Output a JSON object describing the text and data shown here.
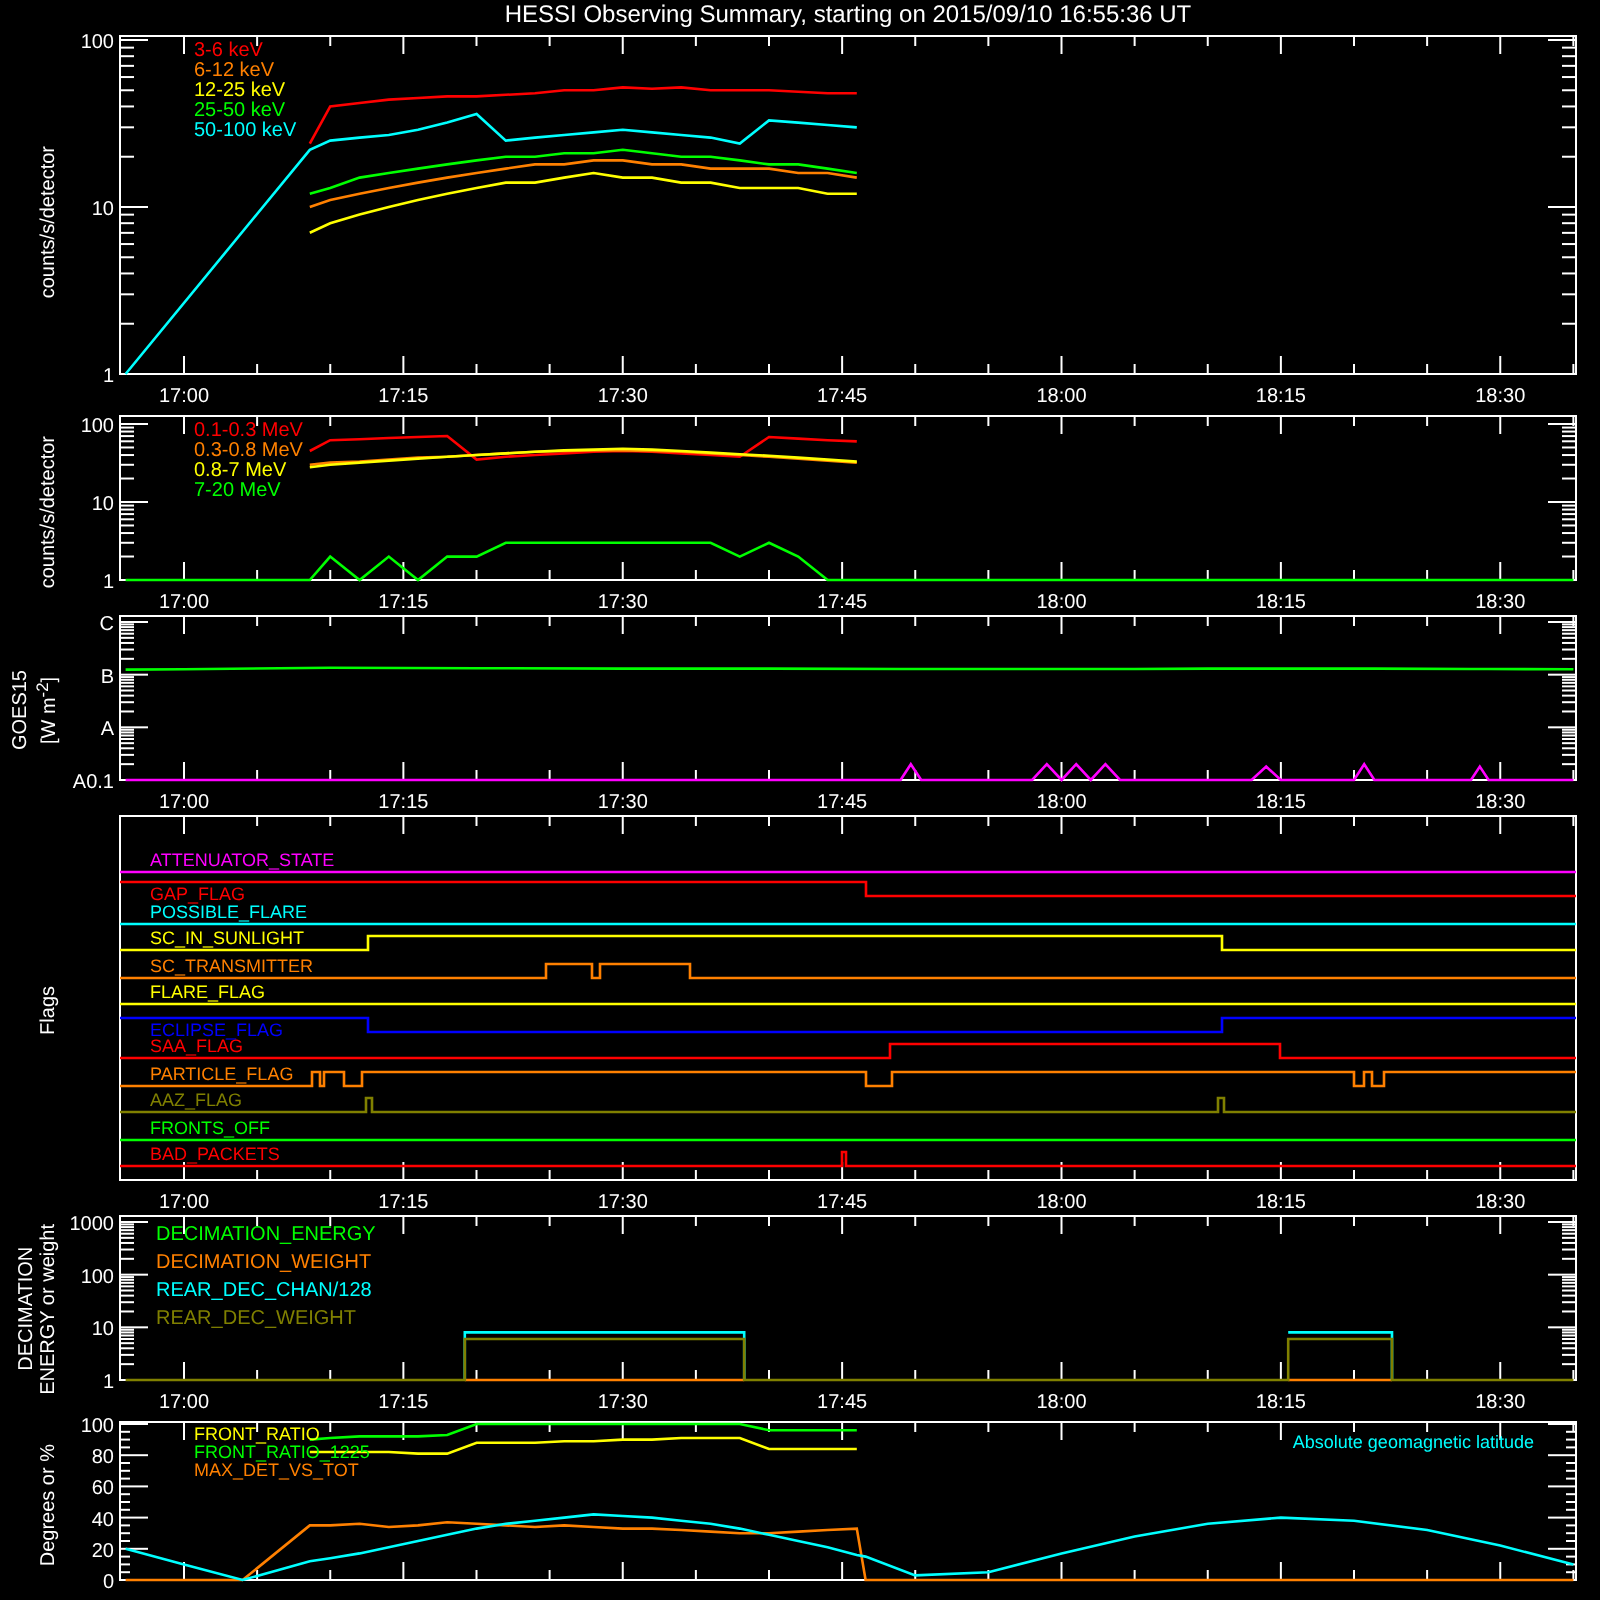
{
  "title": "HESSI Observing Summary, starting on 2015/09/10 16:55:36 UT",
  "panels": [
    {
      "kind": "plot",
      "ylabel": "counts/s/detector",
      "ytick_labels": [
        "100",
        "10",
        "1"
      ],
      "time_labels": [
        "17:00",
        "17:15",
        "17:30",
        "17:45",
        "18:00",
        "18:15",
        "18:30"
      ],
      "legend": [
        {
          "name": "3-6 keV",
          "color": "#ff0000"
        },
        {
          "name": "6-12 keV",
          "color": "#ff8000"
        },
        {
          "name": "12-25 keV",
          "color": "#ffff00"
        },
        {
          "name": "25-50 keV",
          "color": "#00ff00"
        },
        {
          "name": "50-100 keV",
          "color": "#00ffff"
        }
      ]
    },
    {
      "kind": "plot",
      "ylabel": "counts/s/detector",
      "ytick_labels": [
        "100",
        "10",
        "1"
      ],
      "time_labels": [
        "17:00",
        "17:15",
        "17:30",
        "17:45",
        "18:00",
        "18:15",
        "18:30"
      ],
      "legend": [
        {
          "name": "0.1-0.3 MeV",
          "color": "#ff0000"
        },
        {
          "name": "0.3-0.8 MeV",
          "color": "#ff8000"
        },
        {
          "name": "0.8-7 MeV",
          "color": "#ffff00"
        },
        {
          "name": "7-20 MeV",
          "color": "#00ff00"
        }
      ]
    },
    {
      "kind": "plot",
      "ylabel": [
        "GOES15",
        "[W m$^{-2}$]"
      ],
      "ytick_labels": [
        "C",
        "B",
        "A",
        "A0.1"
      ],
      "time_labels": [
        "17:00",
        "17:15",
        "17:30",
        "17:45",
        "18:00",
        "18:15",
        "18:30"
      ]
    },
    {
      "kind": "flags",
      "ylabel": "Flags",
      "time_labels": [
        "17:00",
        "17:15",
        "17:30",
        "17:45",
        "18:00",
        "18:15",
        "18:30"
      ],
      "flags": [
        {
          "name": "ATTENUATOR_STATE",
          "color": "#ff00ff"
        },
        {
          "name": "GAP_FLAG",
          "color": "#ff0000"
        },
        {
          "name": "POSSIBLE_FLARE",
          "color": "#00ffff"
        },
        {
          "name": "SC_IN_SUNLIGHT",
          "color": "#ffff00"
        },
        {
          "name": "SC_TRANSMITTER",
          "color": "#ff8000"
        },
        {
          "name": "FLARE_FLAG",
          "color": "#ffff00"
        },
        {
          "name": "ECLIPSE_FLAG",
          "color": "#0000ff"
        },
        {
          "name": "SAA_FLAG",
          "color": "#ff0000"
        },
        {
          "name": "PARTICLE_FLAG",
          "color": "#ff8000"
        },
        {
          "name": "AAZ_FLAG",
          "color": "#808000"
        },
        {
          "name": "FRONTS_OFF",
          "color": "#00ff00"
        },
        {
          "name": "BAD_PACKETS",
          "color": "#ff0000"
        }
      ]
    },
    {
      "kind": "plot",
      "ylabel": [
        "DECIMATION",
        "ENERGY or weight"
      ],
      "ytick_labels": [
        "1000",
        "100",
        "10",
        "1"
      ],
      "time_labels": [
        "17:00",
        "17:15",
        "17:30",
        "17:45",
        "18:00",
        "18:15",
        "18:30"
      ],
      "legend": [
        {
          "name": "DECIMATION_ENERGY",
          "color": "#00ff00"
        },
        {
          "name": "DECIMATION_WEIGHT",
          "color": "#ff8000"
        },
        {
          "name": "REAR_DEC_CHAN/128",
          "color": "#00ffff"
        },
        {
          "name": "REAR_DEC_WEIGHT",
          "color": "#808000"
        }
      ]
    },
    {
      "kind": "plot",
      "ylabel": "Degrees or %",
      "ytick_labels": [
        "100",
        "80",
        "60",
        "40",
        "20",
        "0"
      ],
      "legend": [
        {
          "name": "FRONT_RATIO",
          "color": "#ffff00"
        },
        {
          "name": "FRONT_RATIO_1225",
          "color": "#00ff00"
        },
        {
          "name": "MAX_DET_VS_TOT",
          "color": "#ff8000"
        },
        {
          "name": "Absolute geomagnetic latitude",
          "color": "#00ffff"
        }
      ]
    }
  ]
}
